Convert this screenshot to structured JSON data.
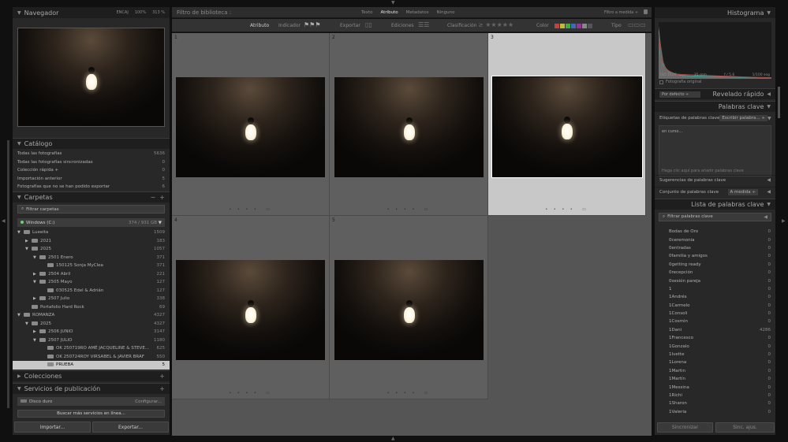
{
  "left": {
    "navigator": {
      "title": "Navegador",
      "opt1": "ENCAJ",
      "opt2": "100%",
      "opt3": "313 %"
    },
    "catalog": {
      "title": "Catálogo",
      "items": [
        {
          "label": "Todas las fotografías",
          "count": "5636"
        },
        {
          "label": "Todas las fotografías sincronizadas",
          "count": "0"
        },
        {
          "label": "Colección rápida +",
          "count": "0"
        },
        {
          "label": "Importación anterior",
          "count": "5"
        },
        {
          "label": "Fotografías que no se han podido exportar",
          "count": "6"
        }
      ]
    },
    "folders": {
      "title": "Carpetas",
      "filter": "Filtrar carpetas",
      "volume": "Windows (C:)",
      "volume_info": "374 / 931 GB",
      "items": [
        {
          "label": "Lueeita",
          "count": "1509"
        },
        {
          "label": "2021",
          "count": "183"
        },
        {
          "label": "2025",
          "count": "1057"
        },
        {
          "label": "2501 Enero",
          "count": "371"
        },
        {
          "label": "150125 Sonja MyClea",
          "count": "371"
        },
        {
          "label": "2504 Abril",
          "count": "221"
        },
        {
          "label": "2505 Mayo",
          "count": "127"
        },
        {
          "label": "030525 Edel & Adrián",
          "count": "127"
        },
        {
          "label": "2507 Julio",
          "count": "338"
        },
        {
          "label": "Portafolio Hard Rock",
          "count": "69"
        },
        {
          "label": "ROMANZA",
          "count": "4327"
        },
        {
          "label": "2025",
          "count": "4327"
        },
        {
          "label": "2506 JUNIO",
          "count": "3147"
        },
        {
          "label": "2507 JULIO",
          "count": "1180"
        },
        {
          "label": "OK 250719RO AMÉ JACQUELINE & STEVE...",
          "count": "625"
        },
        {
          "label": "OK 250724ROY VIRSABEL & JAVIER BRAF",
          "count": "550"
        },
        {
          "label": "PRUEBA",
          "count": "5"
        }
      ]
    },
    "collections": {
      "title": "Colecciones"
    },
    "publish": {
      "title": "Servicios de publicación",
      "disk": "Disco duro",
      "config": "Configurar...",
      "more": "Buscar más servicios en línea..."
    },
    "import_btn": "Importar...",
    "export_btn": "Exportar..."
  },
  "center": {
    "filter_title": "Filtro de biblioteca :",
    "filter_tabs": [
      "Texto",
      "Atributo",
      "Metadatos",
      "Ninguno"
    ],
    "custom": "Filtro a medida ÷",
    "attr": {
      "atributo": "Atributo",
      "indicador": "Indicador",
      "exportar": "Exportar",
      "ediciones": "Ediciones",
      "clasificacion": "Clasificación",
      "color": "Color",
      "tipo": "Tipo"
    },
    "cells": [
      {
        "num": "1"
      },
      {
        "num": "2"
      },
      {
        "num": "3"
      },
      {
        "num": "4"
      },
      {
        "num": "5"
      }
    ]
  },
  "right": {
    "histogram": {
      "title": "Histograma",
      "iso": "ISO 1600",
      "focal": "35 mm",
      "aperture": "f / 5.6",
      "shutter": "1/100 seg",
      "original": "Fotografía original"
    },
    "quick_dev": {
      "title": "Revelado rápido",
      "preset": "Por defecto"
    },
    "keywords": {
      "title": "Palabras clave",
      "tags_label": "Etiquetas de palabras clave",
      "tags_value": "Escribir palabra...",
      "current": "en curso...",
      "hint": "Haga clic aquí para añadir palabras clave",
      "suggest": "Sugerencias de palabras clave",
      "set": "Conjunto de palabras clave",
      "set_value": "A medida"
    },
    "kwlist": {
      "title": "Lista de palabras clave",
      "filter": "Filtrar palabras clave",
      "items": [
        {
          "label": "Bodas de Oro",
          "count": "0"
        },
        {
          "label": "0ceremonia",
          "count": "0"
        },
        {
          "label": "0entradas",
          "count": "0"
        },
        {
          "label": "0familia y amigos",
          "count": "0"
        },
        {
          "label": "0getting ready",
          "count": "0"
        },
        {
          "label": "0recepción",
          "count": "0"
        },
        {
          "label": "0sesión pareja",
          "count": "0"
        },
        {
          "label": "1",
          "count": "0"
        },
        {
          "label": "1Andrés",
          "count": "0"
        },
        {
          "label": "1Carmelo",
          "count": "0"
        },
        {
          "label": "1Consoli",
          "count": "0"
        },
        {
          "label": "1Cosmin",
          "count": "0"
        },
        {
          "label": "1Dani",
          "count": "4286"
        },
        {
          "label": "1Francesco",
          "count": "0"
        },
        {
          "label": "1Gonzalo",
          "count": "0"
        },
        {
          "label": "1Ivette",
          "count": "0"
        },
        {
          "label": "1Lorena",
          "count": "0"
        },
        {
          "label": "1Martin",
          "count": "0"
        },
        {
          "label": "1Martín",
          "count": "0"
        },
        {
          "label": "1Messina",
          "count": "0"
        },
        {
          "label": "1Richi",
          "count": "0"
        },
        {
          "label": "1Sharon",
          "count": "0"
        },
        {
          "label": "1Valeria",
          "count": "0"
        }
      ]
    },
    "sync_meta": "Sincronizar",
    "sync_set": "Sinc. ajus."
  }
}
